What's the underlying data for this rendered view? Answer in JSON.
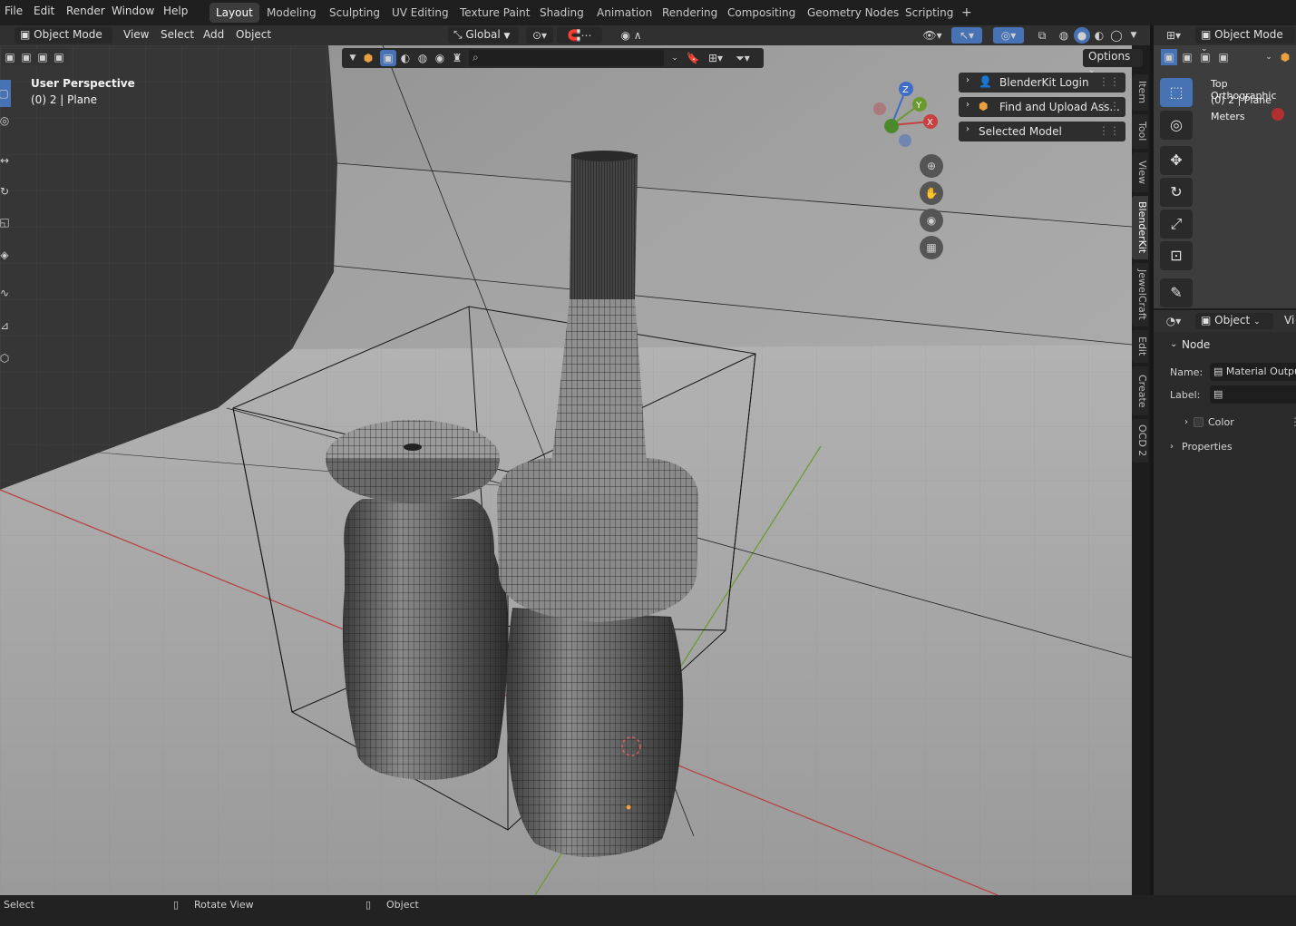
{
  "menubar": {
    "file": "File",
    "edit": "Edit",
    "render": "Render",
    "window": "Window",
    "help": "Help",
    "workspaces": [
      "Layout",
      "Modeling",
      "Sculpting",
      "UV Editing",
      "Texture Paint",
      "Shading",
      "Animation",
      "Rendering",
      "Compositing",
      "Geometry Nodes",
      "Scripting"
    ],
    "active_workspace": "Layout",
    "add_workspace": "+"
  },
  "viewport_header": {
    "mode": "Object Mode",
    "menus": [
      "View",
      "Select",
      "Add",
      "Object"
    ],
    "transform_orientation": "Global",
    "options": "Options"
  },
  "viewport": {
    "perspective_label": "User Perspective",
    "object_label": "(0) 2 | Plane",
    "gizmo": {
      "z": "Z",
      "y": "Y",
      "x": "X"
    }
  },
  "npanel": {
    "rows": [
      "BlenderKit Login",
      "Find and Upload Ass...",
      "Selected Model"
    ],
    "tabs": [
      "Item",
      "Tool",
      "View",
      "BlenderKit",
      "JewelCraft",
      "Edit",
      "Create",
      "OCD 2"
    ],
    "active_tab": "BlenderKit"
  },
  "right_viewport": {
    "mode": "Object Mode",
    "perspective_label": "Top Orthographic",
    "object_label": "(0) 2 | Plane",
    "units": "Meters"
  },
  "node_panel": {
    "context": "Object",
    "view_cut": "Vi",
    "section": "Node",
    "name_label": "Name:",
    "name_value": "Material Outpu",
    "label_label": "Label:",
    "label_value": "",
    "color": "Color",
    "properties": "Properties"
  },
  "statusbar": {
    "select": "Select",
    "rotate": "Rotate View",
    "object": "Object"
  },
  "colors": {
    "accent": "#4772b3",
    "x_axis": "#c8403f",
    "y_axis": "#6a9a2e",
    "z_axis": "#3d6dc8"
  }
}
